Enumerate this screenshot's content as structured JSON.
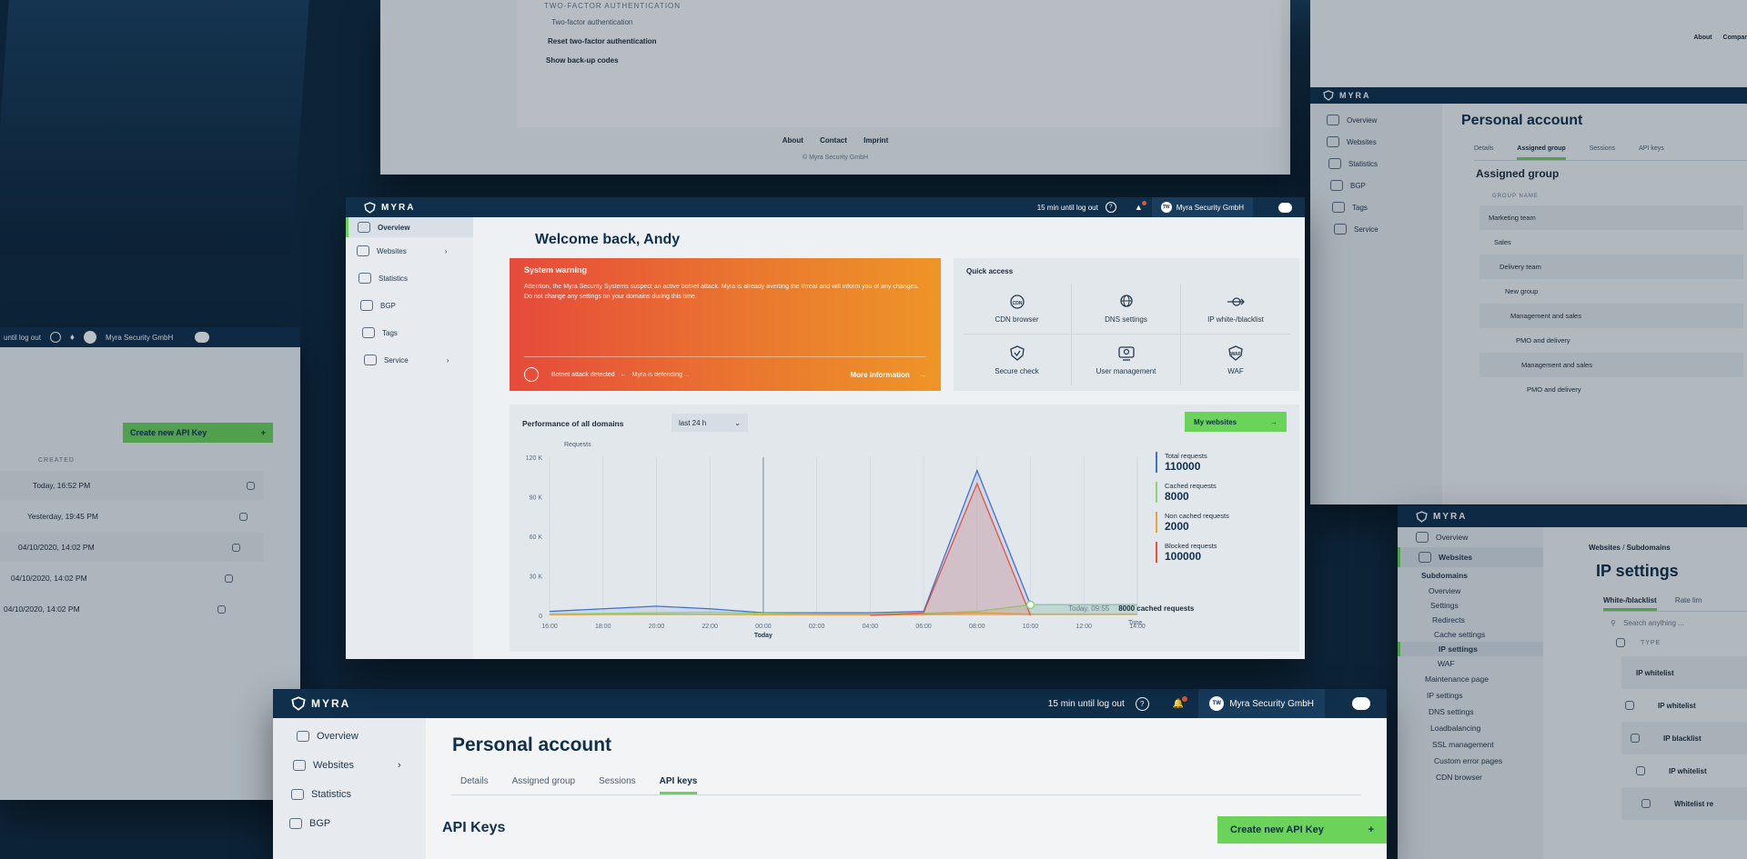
{
  "brand": "MYRA",
  "topbar": {
    "logout_timer": "15 min until log out",
    "account_name": "Myra Security GmbH",
    "avatar_initials": "TW"
  },
  "top_screen": {
    "section": "TWO-FACTOR AUTHENTICATION",
    "link1": "Two-factor authentication",
    "link2": "Reset two-factor authentication",
    "link3": "Show back-up codes",
    "footer_about": "About",
    "footer_contact": "Contact",
    "footer_imprint": "Imprint",
    "copyright": "© Myra Security GmbH"
  },
  "main": {
    "sidebar": [
      {
        "label": "Overview",
        "active": true
      },
      {
        "label": "Websites",
        "active": false,
        "chevron": true
      },
      {
        "label": "Statistics",
        "active": false
      },
      {
        "label": "BGP",
        "active": false
      },
      {
        "label": "Tags",
        "active": false
      },
      {
        "label": "Service",
        "active": false,
        "chevron": true
      }
    ],
    "welcome": "Welcome back, Andy",
    "warning": {
      "title": "System warning",
      "text": "Attention, the Myra Security Systems suspect an active botnet attack. Myra is already averting the threat and will inform you of any changes. Do not change any settings on your domains during this time.",
      "status": "Botnet attack detected",
      "defending": "Myra is defending ...",
      "more": "More information"
    },
    "quick_access": {
      "title": "Quick access",
      "items": [
        "CDN browser",
        "DNS settings",
        "IP white-/blacklist",
        "Secure check",
        "User management",
        "WAF"
      ],
      "icon_names": [
        "cdn-icon",
        "dns-icon",
        "ip-list-icon",
        "secure-check-icon",
        "user-management-icon",
        "waf-icon"
      ]
    },
    "performance": {
      "title": "Performance of all domains",
      "range": "last 24 h",
      "my_websites": "My websites",
      "tooltip_time": "Today, 09:55",
      "tooltip_value": "8000 cached requests"
    }
  },
  "chart_data": {
    "type": "line",
    "ylabel": "Requests",
    "xlabel": "Time",
    "x_sublabel": "Today",
    "yticks": [
      "0",
      "30 K",
      "60 K",
      "90 K",
      "120 K"
    ],
    "ylim": [
      0,
      120000
    ],
    "categories": [
      "16:00",
      "18:00",
      "20:00",
      "22:00",
      "00:00",
      "02:00",
      "04:00",
      "06:00",
      "08:00",
      "10:00",
      "12:00",
      "14:00"
    ],
    "series": [
      {
        "name": "Total requests",
        "color": "#3f6fd1",
        "total": "110000",
        "values": [
          3000,
          5000,
          7000,
          5000,
          2000,
          2000,
          2000,
          3000,
          110000,
          8000,
          8000,
          8000
        ]
      },
      {
        "name": "Cached requests",
        "color": "#8bd37a",
        "total": "8000",
        "values": [
          1000,
          1500,
          2000,
          2500,
          1500,
          1000,
          1000,
          1500,
          3000,
          8000,
          8000,
          8000
        ]
      },
      {
        "name": "Non cached requests",
        "color": "#e8a23a",
        "total": "2000",
        "values": [
          500,
          800,
          1000,
          900,
          500,
          400,
          400,
          800,
          2000,
          1000,
          1000,
          1000
        ]
      },
      {
        "name": "Blocked requests",
        "color": "#e5523a",
        "total": "100000",
        "values": [
          null,
          null,
          null,
          null,
          null,
          null,
          0,
          2000,
          100000,
          0,
          null,
          null
        ]
      }
    ]
  },
  "bottom_screen": {
    "sidebar": [
      "Overview",
      "Websites",
      "Statistics",
      "BGP"
    ],
    "title": "Personal account",
    "tabs": [
      "Details",
      "Assigned group",
      "Sessions",
      "API keys"
    ],
    "section": "API Keys",
    "create_btn": "Create new API Key"
  },
  "left_screen": {
    "create_btn": "Create new API Key",
    "column": "CREATED",
    "rows": [
      "Today, 16:52 PM",
      "Yesterday, 19:45 PM",
      "04/10/2020, 14:02 PM",
      "04/10/2020, 14:02 PM",
      "04/10/2020, 14:02 PM"
    ],
    "account_name": "Myra Security GmbH",
    "logout_fragment": "until log out"
  },
  "right_top_screen": {
    "footer_about": "About",
    "footer_contact": "Compar",
    "sidebar": [
      "Overview",
      "Websites",
      "Statistics",
      "BGP",
      "Tags",
      "Service"
    ],
    "title": "Personal account",
    "tabs": [
      "Details",
      "Assigned group",
      "Sessions",
      "API keys"
    ],
    "section": "Assigned group",
    "column": "GROUP NAME",
    "groups": [
      "Marketing team",
      "Sales",
      "Delivery team",
      "New group",
      "Management and sales",
      "PMO and delivery",
      "Management and sales",
      "PMO and delivery"
    ]
  },
  "right_bottom_screen": {
    "breadcrumb1": "Websites",
    "breadcrumb2": "Subdomains",
    "title": "IP settings",
    "tab": "White-/blacklist",
    "tab2": "Rate lim",
    "search_placeholder": "Search anything ...",
    "column": "TYPE",
    "rows": [
      "IP whitelist",
      "IP whitelist",
      "IP blacklist",
      "IP whitelist",
      "Whitelist re"
    ],
    "sidebar": [
      "Overview",
      "Websites",
      "Subdomains",
      "Overview",
      "Settings",
      "Redirects",
      "Cache settings",
      "IP settings",
      "WAF",
      "Maintenance page",
      "IP settings",
      "DNS settings",
      "Loadbalancing",
      "SSL management",
      "Custom error pages",
      "CDN browser"
    ]
  }
}
